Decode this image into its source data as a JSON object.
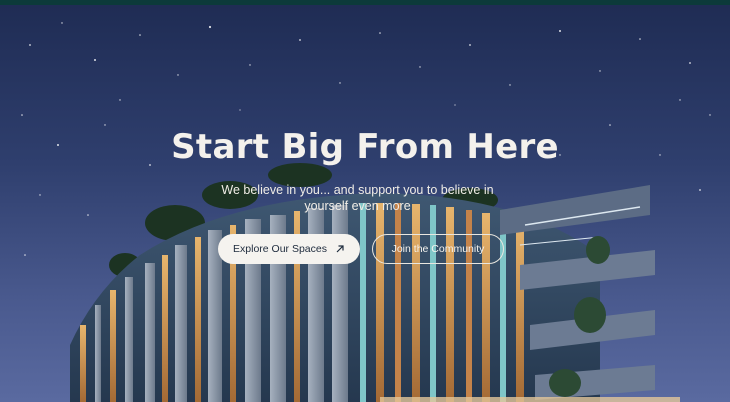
{
  "hero": {
    "title": "Start Big From Here",
    "subtitle": "We believe in you... and support you to believe in yourself even more",
    "primary_button": {
      "label": "Explore Our Spaces",
      "icon": "arrow-up-right-icon"
    },
    "secondary_button": {
      "label": "Join the Community"
    }
  },
  "colors": {
    "topbar": "#0c3a3a",
    "sky": "#2f3f6e",
    "title": "#f4f1ec",
    "primary_button_bg": "#f5f3ef",
    "primary_button_text": "#1e2b3d"
  }
}
